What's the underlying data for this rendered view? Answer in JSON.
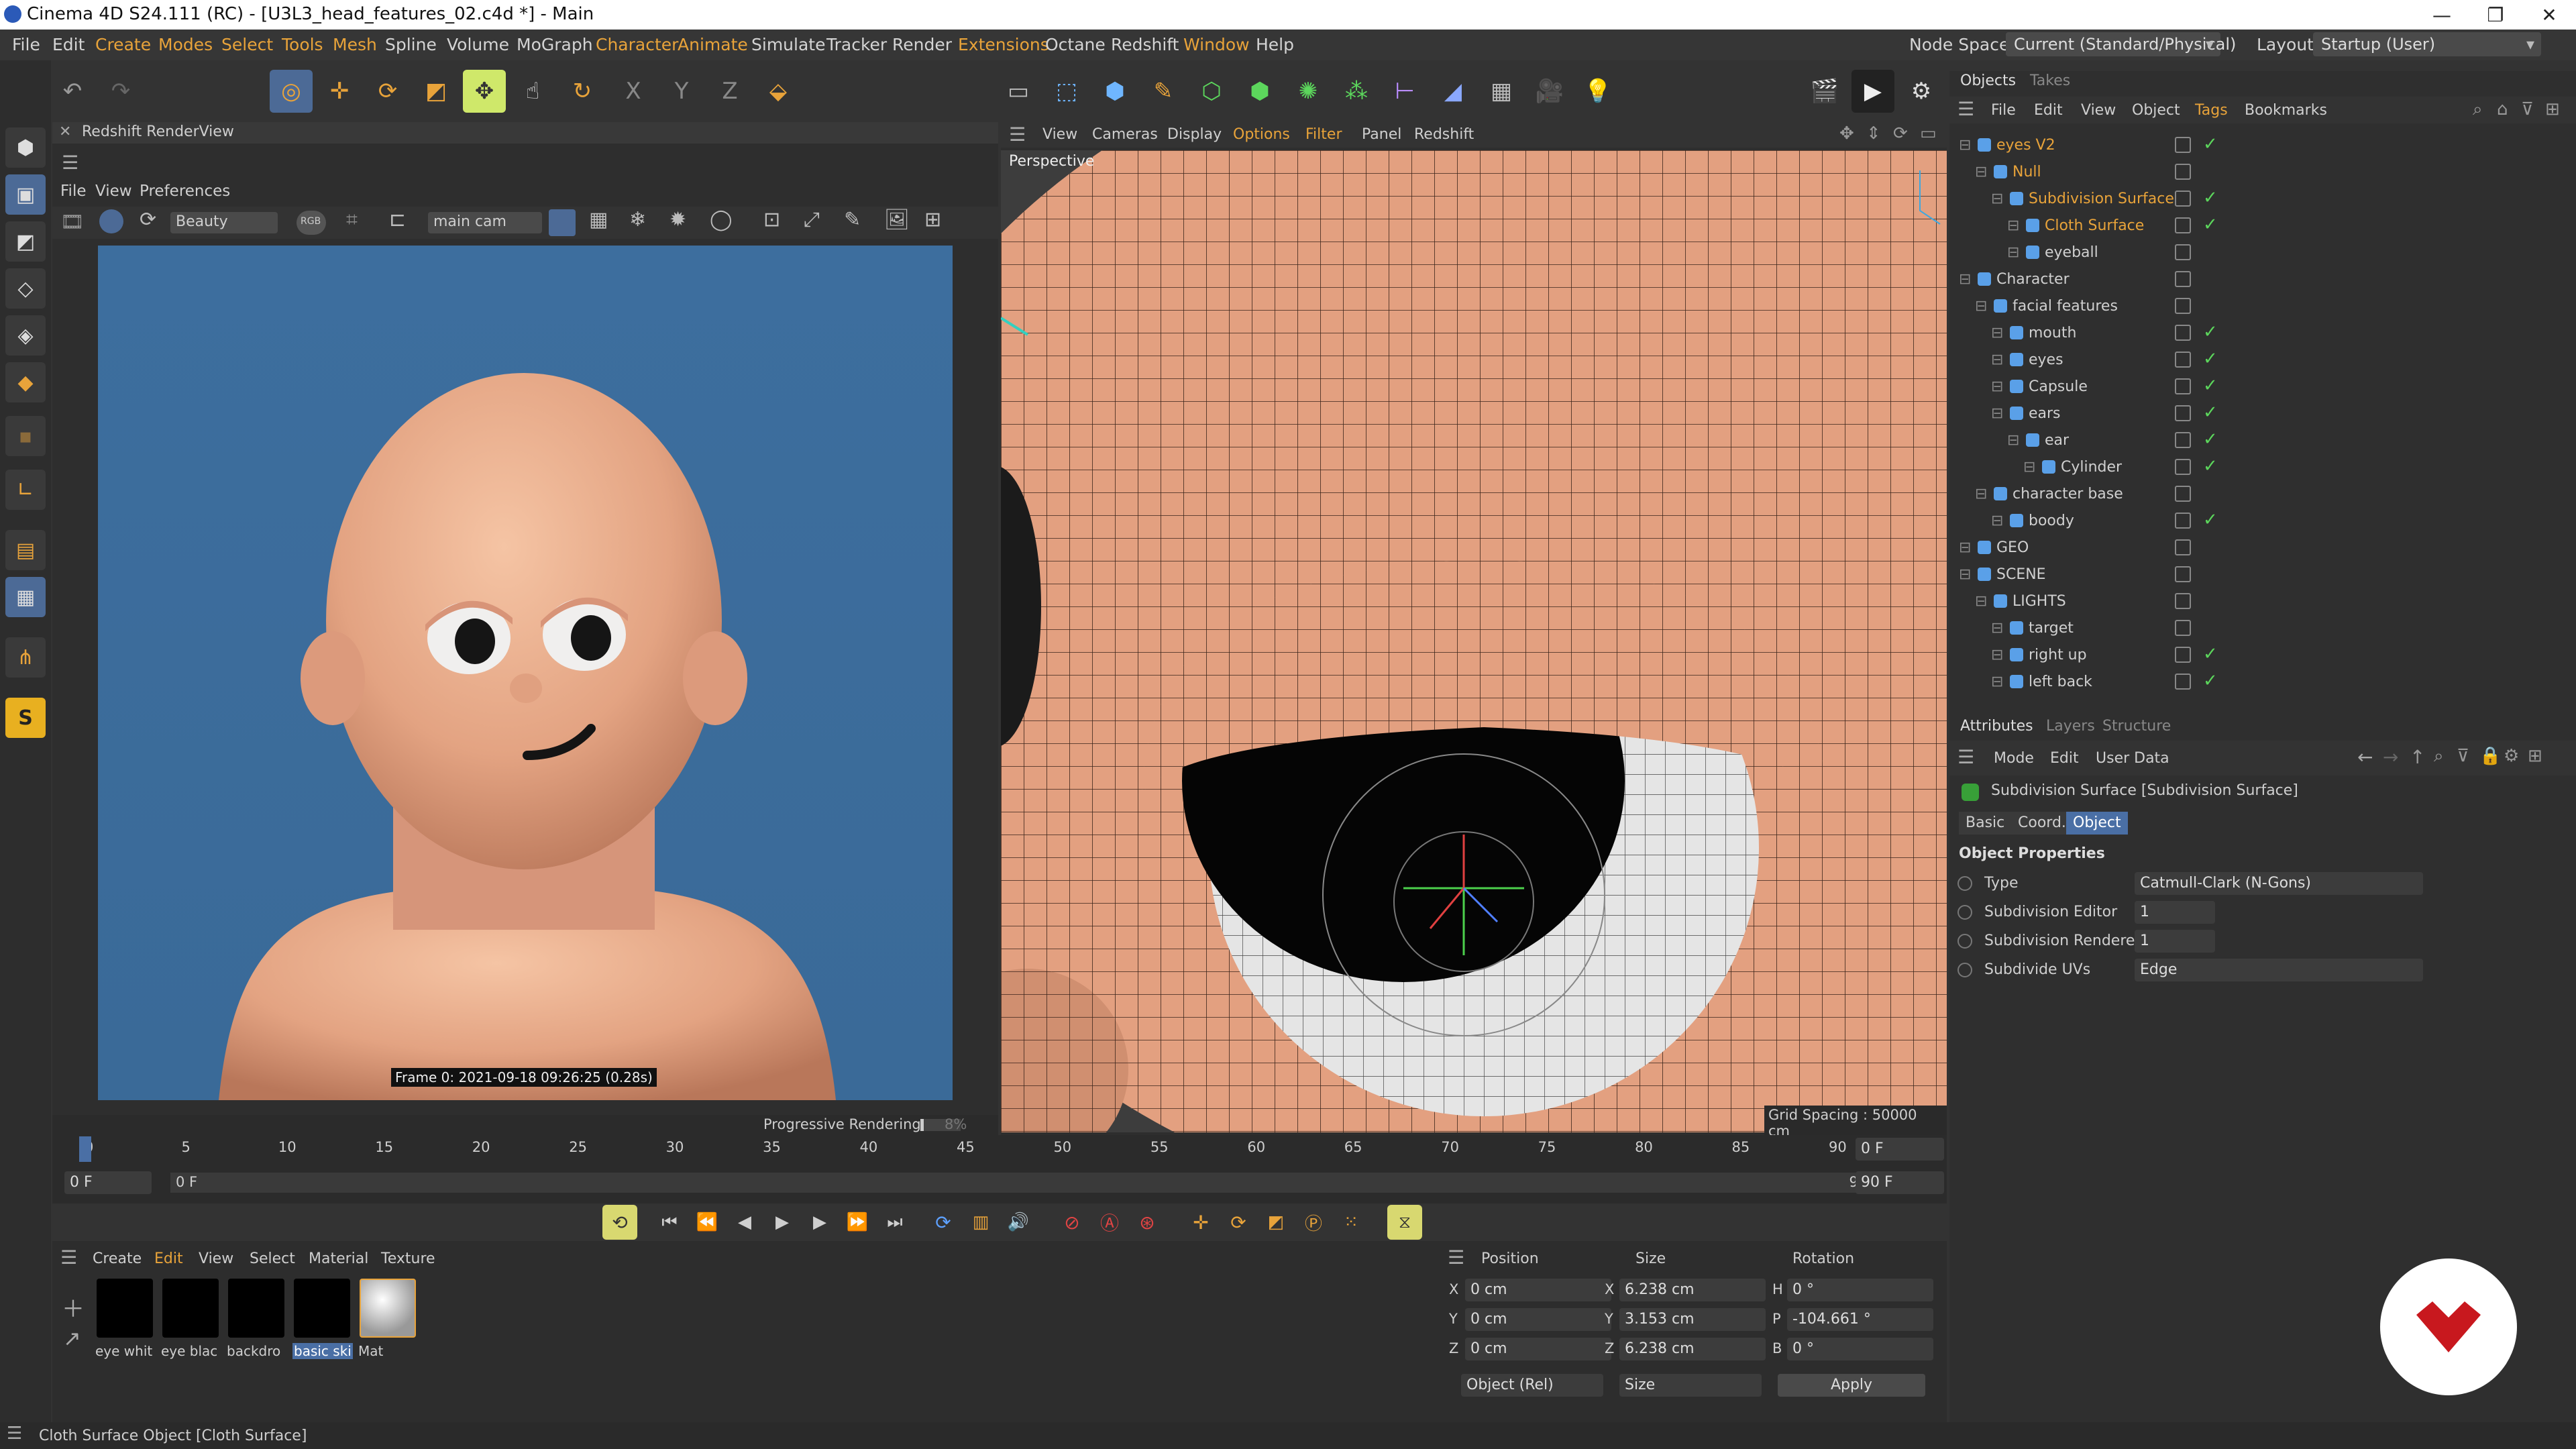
{
  "window": {
    "title": "Cinema 4D S24.111 (RC) - [U3L3_head_features_02.c4d *] - Main"
  },
  "menus": [
    "File",
    "Edit",
    "Create",
    "Modes",
    "Select",
    "Tools",
    "Mesh",
    "Spline",
    "Volume",
    "MoGraph",
    "Character",
    "Animate",
    "Simulate",
    "Tracker",
    "Render",
    "Extensions",
    "Octane",
    "Redshift",
    "Window",
    "Help"
  ],
  "node_space": {
    "label": "Node Space:",
    "value": "Current (Standard/Physical)"
  },
  "layout": {
    "label": "Layout:",
    "value": "Startup (User)"
  },
  "renderview": {
    "title": "Redshift RenderView",
    "menus": [
      "File",
      "View",
      "Preferences"
    ],
    "aov": "Beauty",
    "rgb": "RGB",
    "camera": "main cam",
    "frame_info": "Frame  0:  2021-09-18  09:26:25  (0.28s)",
    "progress_label": "Progressive Rendering...",
    "progress_percent": "8%",
    "progress": 0.08
  },
  "viewport": {
    "menus": [
      "View",
      "Cameras",
      "Display",
      "Options",
      "Filter",
      "Panel",
      "Redshift"
    ],
    "label": "Perspective",
    "grid_spacing": "Grid Spacing : 50000 cm"
  },
  "objects_panel": {
    "tabs": [
      "Objects",
      "Takes"
    ],
    "menus": [
      "File",
      "Edit",
      "View",
      "Object",
      "Tags",
      "Bookmarks"
    ],
    "rows": [
      {
        "name": "eyes V2",
        "color": "#e8a33a",
        "indent": 0,
        "check": true
      },
      {
        "name": "Null",
        "color": "#e8a33a",
        "indent": 1,
        "check": false
      },
      {
        "name": "Subdivision Surface",
        "color": "#e8a33a",
        "indent": 2,
        "check": true
      },
      {
        "name": "Cloth Surface",
        "color": "#e8a33a",
        "indent": 3,
        "check": true
      },
      {
        "name": "eyeball",
        "color": "#d0d0d0",
        "indent": 3,
        "check": false
      },
      {
        "name": "Character",
        "color": "#d0d0d0",
        "indent": 0,
        "check": false
      },
      {
        "name": "facial features",
        "color": "#d0d0d0",
        "indent": 1,
        "check": false
      },
      {
        "name": "mouth",
        "color": "#d0d0d0",
        "indent": 2,
        "check": true
      },
      {
        "name": "eyes",
        "color": "#d0d0d0",
        "indent": 2,
        "check": true
      },
      {
        "name": "Capsule",
        "color": "#d0d0d0",
        "indent": 2,
        "check": true
      },
      {
        "name": "ears",
        "color": "#d0d0d0",
        "indent": 2,
        "check": true
      },
      {
        "name": "ear",
        "color": "#d0d0d0",
        "indent": 3,
        "check": true
      },
      {
        "name": "Cylinder",
        "color": "#d0d0d0",
        "indent": 4,
        "check": true
      },
      {
        "name": "character base",
        "color": "#d0d0d0",
        "indent": 1,
        "check": false
      },
      {
        "name": "boody",
        "color": "#d0d0d0",
        "indent": 2,
        "check": true
      },
      {
        "name": "GEO",
        "color": "#d0d0d0",
        "indent": 0,
        "check": false
      },
      {
        "name": "SCENE",
        "color": "#d0d0d0",
        "indent": 0,
        "check": false
      },
      {
        "name": "LIGHTS",
        "color": "#d0d0d0",
        "indent": 1,
        "check": false
      },
      {
        "name": "target",
        "color": "#d0d0d0",
        "indent": 2,
        "check": false
      },
      {
        "name": "right up",
        "color": "#d0d0d0",
        "indent": 2,
        "check": true
      },
      {
        "name": "left back",
        "color": "#d0d0d0",
        "indent": 2,
        "check": true
      }
    ]
  },
  "attributes": {
    "tabs": [
      "Attributes",
      "Layers",
      "Structure"
    ],
    "menus": [
      "Mode",
      "Edit",
      "User Data"
    ],
    "object_title": "Subdivision Surface [Subdivision Surface]",
    "subtabs": [
      "Basic",
      "Coord.",
      "Object"
    ],
    "section": "Object Properties",
    "props": [
      {
        "label": "Type",
        "value": "Catmull-Clark (N-Gons)",
        "kind": "dropdown"
      },
      {
        "label": "Subdivision Editor",
        "value": "1",
        "kind": "number"
      },
      {
        "label": "Subdivision Renderer",
        "value": "1",
        "kind": "number"
      },
      {
        "label": "Subdivide UVs",
        "value": "Edge",
        "kind": "dropdown"
      }
    ]
  },
  "timeline": {
    "ticks": [
      "0",
      "5",
      "10",
      "15",
      "20",
      "25",
      "30",
      "35",
      "40",
      "45",
      "50",
      "55",
      "60",
      "65",
      "70",
      "75",
      "80",
      "85",
      "90"
    ],
    "current_frame": "0 F",
    "start": "0 F",
    "range_start": "0 F",
    "range_end": "90 F",
    "end": "90 F"
  },
  "material_panel": {
    "menus": [
      "Create",
      "Edit",
      "View",
      "Select",
      "Material",
      "Texture"
    ],
    "materials": [
      {
        "name": "eye whit",
        "swatch": "#000000"
      },
      {
        "name": "eye blac",
        "swatch": "#000000"
      },
      {
        "name": "backdro",
        "swatch": "#000000"
      },
      {
        "name": "basic ski",
        "swatch": "#000000",
        "selected": true
      },
      {
        "name": "Mat",
        "swatch": "#c8c8c8"
      }
    ]
  },
  "coords": {
    "headers": [
      "Position",
      "Size",
      "Rotation"
    ],
    "rows": [
      {
        "axis": "X",
        "pos": "0 cm",
        "size_axis": "X",
        "size": "6.238 cm",
        "rot_axis": "H",
        "rot": "0 °"
      },
      {
        "axis": "Y",
        "pos": "0 cm",
        "size_axis": "Y",
        "size": "3.153 cm",
        "rot_axis": "P",
        "rot": "-104.661 °"
      },
      {
        "axis": "Z",
        "pos": "0 cm",
        "size_axis": "Z",
        "size": "6.238 cm",
        "rot_axis": "B",
        "rot": "0 °"
      }
    ],
    "mode": "Object (Rel)",
    "size_mode": "Size",
    "apply": "Apply"
  },
  "status": {
    "text": "Cloth Surface Object [Cloth Surface]"
  }
}
